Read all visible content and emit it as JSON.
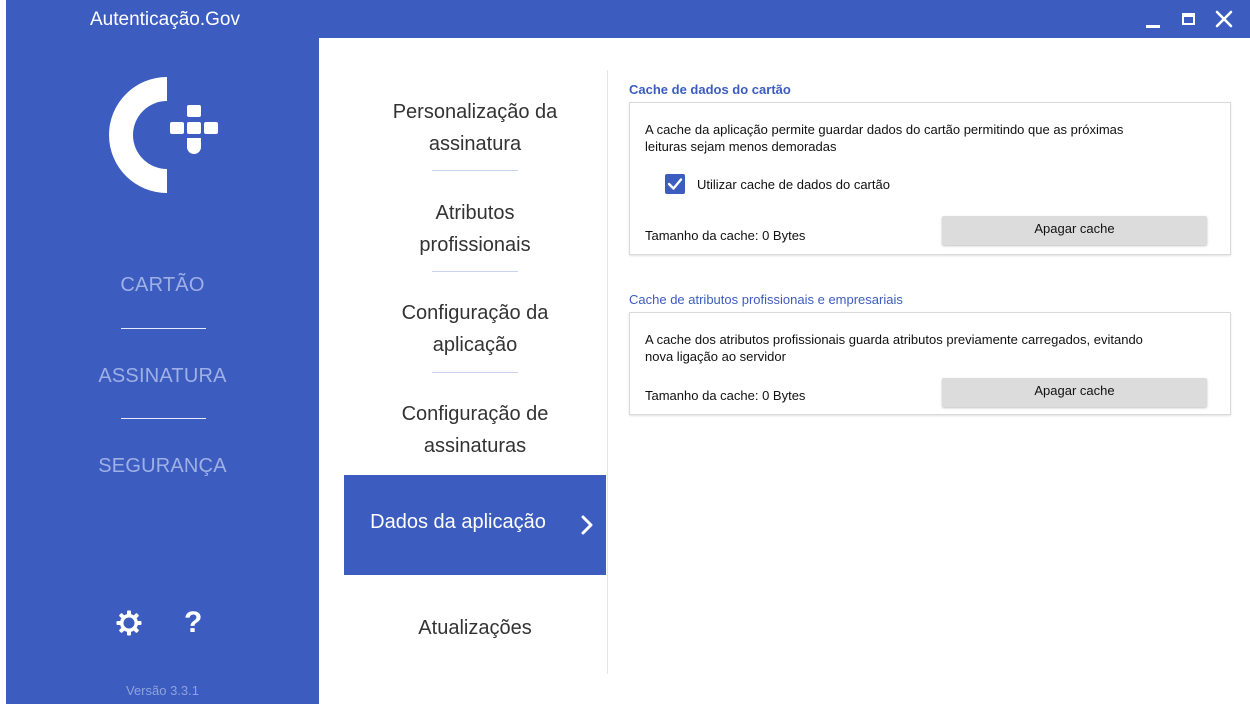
{
  "window": {
    "title": "Autenticação.Gov",
    "minimize_icon": "minimize-icon",
    "maximize_icon": "maximize-icon",
    "close_icon": "close-icon"
  },
  "sidebar": {
    "logo": "autenticacao-gov-logo",
    "items": [
      {
        "label": "CARTÃO"
      },
      {
        "label": "ASSINATURA"
      },
      {
        "label": "SEGURANÇA"
      }
    ],
    "settings_icon": "gear-icon",
    "help_icon": "question-icon",
    "help_glyph": "?",
    "version": "Versão 3.3.1"
  },
  "menu": {
    "items": [
      {
        "line1": "Personalização da",
        "line2": "assinatura"
      },
      {
        "line1": "Atributos",
        "line2": "profissionais"
      },
      {
        "line1": "Configuração da",
        "line2": "aplicação"
      },
      {
        "line1": "Configuração de",
        "line2": "assinaturas"
      },
      {
        "label": "Dados da aplicação",
        "active": true,
        "icon": "chevron-right-icon"
      },
      {
        "label": "Atualizações"
      }
    ]
  },
  "main": {
    "card_cache": {
      "title": "Cache de dados do cartão",
      "description_line1": "A cache da aplicação permite guardar dados do cartão permitindo que as próximas",
      "description_line2": "leituras sejam menos demoradas",
      "checkbox_label": "Utilizar cache de dados do cartão",
      "checkbox_checked": true,
      "size_label": "Tamanho da cache: 0 Bytes",
      "button_label": "Apagar cache"
    },
    "attr_cache": {
      "title": "Cache de atributos profissionais e empresariais",
      "description_line1": "A cache dos atributos profissionais guarda atributos previamente carregados, evitando",
      "description_line2": "nova ligação ao servidor",
      "size_label": "Tamanho da cache: 0 Bytes",
      "button_label": "Apagar cache"
    }
  },
  "colors": {
    "accent": "#3c5dbf",
    "sidebar_text": "#9fb0e6",
    "button_bg": "#dcdcdc"
  }
}
